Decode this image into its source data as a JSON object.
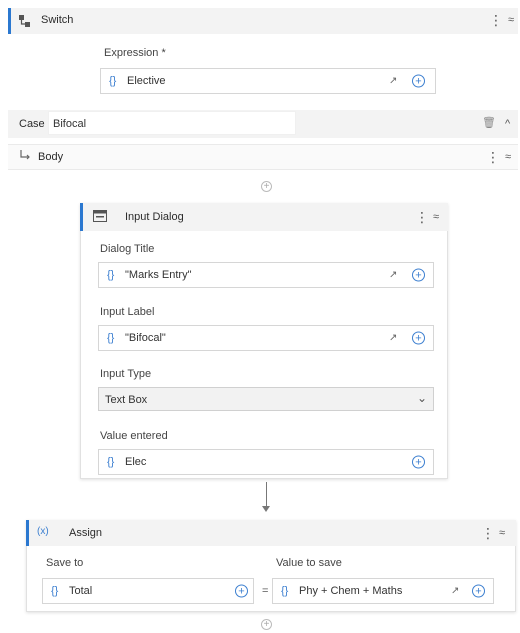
{
  "switch": {
    "title": "Switch",
    "icon": "switch-icon",
    "expression_label": "Expression *",
    "expression_value": "Elective"
  },
  "case": {
    "prefix": "Case",
    "value": "Bifocal"
  },
  "body": {
    "label": "Body"
  },
  "input_dialog": {
    "title": "Input Dialog",
    "dialog_title_label": "Dialog Title",
    "dialog_title_value": "\"Marks Entry\"",
    "input_label_label": "Input Label",
    "input_label_value": "\"Bifocal\"",
    "input_type_label": "Input Type",
    "input_type_value": "Text Box",
    "value_entered_label": "Value entered",
    "value_entered_value": "Elec"
  },
  "assign": {
    "icon_text": "(x)",
    "title": "Assign",
    "save_to_label": "Save to",
    "save_to_value": "Total",
    "equals": "=",
    "value_to_save_label": "Value to save",
    "value_to_save_value": "Phy + Chem + Maths"
  },
  "glyphs": {
    "brace": "{}",
    "plus": "+",
    "kebab": "⋮",
    "collapse": "≈",
    "chevron_up": "^",
    "expand": "↗",
    "dropdown": "⌄",
    "trash": "🗑"
  },
  "colors": {
    "accent": "#2b78d0",
    "header_bg": "#f3f3f3"
  }
}
